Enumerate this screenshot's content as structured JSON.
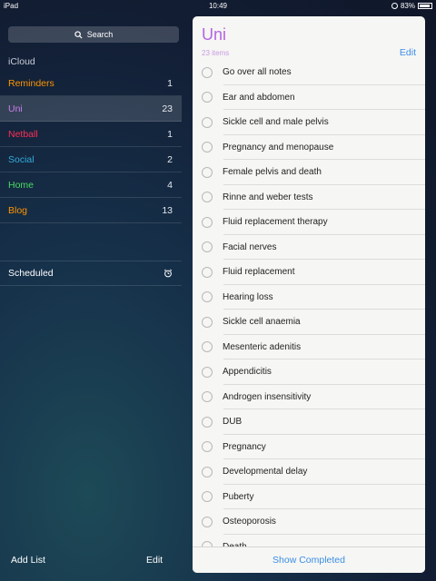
{
  "status": {
    "carrier": "iPad",
    "time": "10:49",
    "battery": "83%"
  },
  "sidebar": {
    "search_label": "Search",
    "account": "iCloud",
    "lists": [
      {
        "name": "Reminders",
        "count": "1",
        "color": "#ff9500"
      },
      {
        "name": "Uni",
        "count": "23",
        "color": "#c97ee8",
        "selected": true
      },
      {
        "name": "Netball",
        "count": "1",
        "color": "#ff2d55"
      },
      {
        "name": "Social",
        "count": "2",
        "color": "#34aadc"
      },
      {
        "name": "Home",
        "count": "4",
        "color": "#4cd964"
      },
      {
        "name": "Blog",
        "count": "13",
        "color": "#ff9500"
      }
    ],
    "scheduled": "Scheduled",
    "add_list": "Add List",
    "edit": "Edit"
  },
  "panel": {
    "title": "Uni",
    "count": "23 items",
    "edit": "Edit",
    "items": [
      "Go over all notes",
      "Ear and abdomen",
      "Sickle cell and male pelvis",
      "Pregnancy and menopause",
      "Female pelvis and death",
      "Rinne and weber tests",
      "Fluid replacement therapy",
      "Facial nerves",
      "Fluid replacement",
      "Hearing loss",
      "Sickle cell anaemia",
      "Mesenteric adenitis",
      "Appendicitis",
      "Androgen insensitivity",
      "DUB",
      "Pregnancy",
      "Developmental delay",
      "Puberty",
      "Osteoporosis",
      "Death"
    ],
    "show_completed": "Show Completed"
  }
}
